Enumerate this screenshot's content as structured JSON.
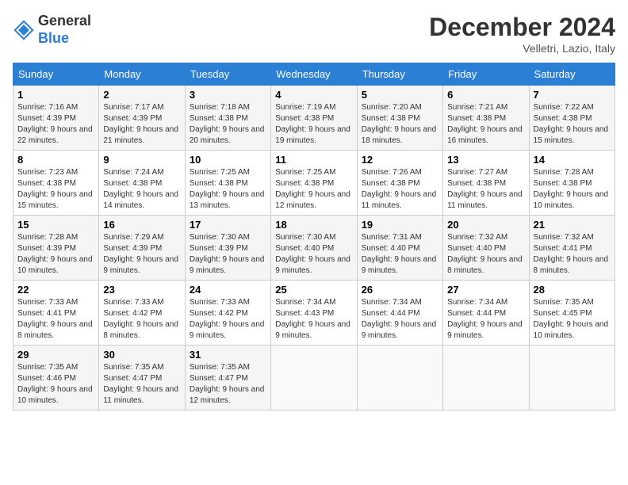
{
  "header": {
    "logo_general": "General",
    "logo_blue": "Blue",
    "month_year": "December 2024",
    "location": "Velletri, Lazio, Italy"
  },
  "weekdays": [
    "Sunday",
    "Monday",
    "Tuesday",
    "Wednesday",
    "Thursday",
    "Friday",
    "Saturday"
  ],
  "weeks": [
    [
      {
        "day": "1",
        "sunrise": "Sunrise: 7:16 AM",
        "sunset": "Sunset: 4:39 PM",
        "daylight": "Daylight: 9 hours and 22 minutes."
      },
      {
        "day": "2",
        "sunrise": "Sunrise: 7:17 AM",
        "sunset": "Sunset: 4:39 PM",
        "daylight": "Daylight: 9 hours and 21 minutes."
      },
      {
        "day": "3",
        "sunrise": "Sunrise: 7:18 AM",
        "sunset": "Sunset: 4:38 PM",
        "daylight": "Daylight: 9 hours and 20 minutes."
      },
      {
        "day": "4",
        "sunrise": "Sunrise: 7:19 AM",
        "sunset": "Sunset: 4:38 PM",
        "daylight": "Daylight: 9 hours and 19 minutes."
      },
      {
        "day": "5",
        "sunrise": "Sunrise: 7:20 AM",
        "sunset": "Sunset: 4:38 PM",
        "daylight": "Daylight: 9 hours and 18 minutes."
      },
      {
        "day": "6",
        "sunrise": "Sunrise: 7:21 AM",
        "sunset": "Sunset: 4:38 PM",
        "daylight": "Daylight: 9 hours and 16 minutes."
      },
      {
        "day": "7",
        "sunrise": "Sunrise: 7:22 AM",
        "sunset": "Sunset: 4:38 PM",
        "daylight": "Daylight: 9 hours and 15 minutes."
      }
    ],
    [
      {
        "day": "8",
        "sunrise": "Sunrise: 7:23 AM",
        "sunset": "Sunset: 4:38 PM",
        "daylight": "Daylight: 9 hours and 15 minutes."
      },
      {
        "day": "9",
        "sunrise": "Sunrise: 7:24 AM",
        "sunset": "Sunset: 4:38 PM",
        "daylight": "Daylight: 9 hours and 14 minutes."
      },
      {
        "day": "10",
        "sunrise": "Sunrise: 7:25 AM",
        "sunset": "Sunset: 4:38 PM",
        "daylight": "Daylight: 9 hours and 13 minutes."
      },
      {
        "day": "11",
        "sunrise": "Sunrise: 7:25 AM",
        "sunset": "Sunset: 4:38 PM",
        "daylight": "Daylight: 9 hours and 12 minutes."
      },
      {
        "day": "12",
        "sunrise": "Sunrise: 7:26 AM",
        "sunset": "Sunset: 4:38 PM",
        "daylight": "Daylight: 9 hours and 11 minutes."
      },
      {
        "day": "13",
        "sunrise": "Sunrise: 7:27 AM",
        "sunset": "Sunset: 4:38 PM",
        "daylight": "Daylight: 9 hours and 11 minutes."
      },
      {
        "day": "14",
        "sunrise": "Sunrise: 7:28 AM",
        "sunset": "Sunset: 4:38 PM",
        "daylight": "Daylight: 9 hours and 10 minutes."
      }
    ],
    [
      {
        "day": "15",
        "sunrise": "Sunrise: 7:28 AM",
        "sunset": "Sunset: 4:39 PM",
        "daylight": "Daylight: 9 hours and 10 minutes."
      },
      {
        "day": "16",
        "sunrise": "Sunrise: 7:29 AM",
        "sunset": "Sunset: 4:39 PM",
        "daylight": "Daylight: 9 hours and 9 minutes."
      },
      {
        "day": "17",
        "sunrise": "Sunrise: 7:30 AM",
        "sunset": "Sunset: 4:39 PM",
        "daylight": "Daylight: 9 hours and 9 minutes."
      },
      {
        "day": "18",
        "sunrise": "Sunrise: 7:30 AM",
        "sunset": "Sunset: 4:40 PM",
        "daylight": "Daylight: 9 hours and 9 minutes."
      },
      {
        "day": "19",
        "sunrise": "Sunrise: 7:31 AM",
        "sunset": "Sunset: 4:40 PM",
        "daylight": "Daylight: 9 hours and 9 minutes."
      },
      {
        "day": "20",
        "sunrise": "Sunrise: 7:32 AM",
        "sunset": "Sunset: 4:40 PM",
        "daylight": "Daylight: 9 hours and 8 minutes."
      },
      {
        "day": "21",
        "sunrise": "Sunrise: 7:32 AM",
        "sunset": "Sunset: 4:41 PM",
        "daylight": "Daylight: 9 hours and 8 minutes."
      }
    ],
    [
      {
        "day": "22",
        "sunrise": "Sunrise: 7:33 AM",
        "sunset": "Sunset: 4:41 PM",
        "daylight": "Daylight: 9 hours and 8 minutes."
      },
      {
        "day": "23",
        "sunrise": "Sunrise: 7:33 AM",
        "sunset": "Sunset: 4:42 PM",
        "daylight": "Daylight: 9 hours and 8 minutes."
      },
      {
        "day": "24",
        "sunrise": "Sunrise: 7:33 AM",
        "sunset": "Sunset: 4:42 PM",
        "daylight": "Daylight: 9 hours and 9 minutes."
      },
      {
        "day": "25",
        "sunrise": "Sunrise: 7:34 AM",
        "sunset": "Sunset: 4:43 PM",
        "daylight": "Daylight: 9 hours and 9 minutes."
      },
      {
        "day": "26",
        "sunrise": "Sunrise: 7:34 AM",
        "sunset": "Sunset: 4:44 PM",
        "daylight": "Daylight: 9 hours and 9 minutes."
      },
      {
        "day": "27",
        "sunrise": "Sunrise: 7:34 AM",
        "sunset": "Sunset: 4:44 PM",
        "daylight": "Daylight: 9 hours and 9 minutes."
      },
      {
        "day": "28",
        "sunrise": "Sunrise: 7:35 AM",
        "sunset": "Sunset: 4:45 PM",
        "daylight": "Daylight: 9 hours and 10 minutes."
      }
    ],
    [
      {
        "day": "29",
        "sunrise": "Sunrise: 7:35 AM",
        "sunset": "Sunset: 4:46 PM",
        "daylight": "Daylight: 9 hours and 10 minutes."
      },
      {
        "day": "30",
        "sunrise": "Sunrise: 7:35 AM",
        "sunset": "Sunset: 4:47 PM",
        "daylight": "Daylight: 9 hours and 11 minutes."
      },
      {
        "day": "31",
        "sunrise": "Sunrise: 7:35 AM",
        "sunset": "Sunset: 4:47 PM",
        "daylight": "Daylight: 9 hours and 12 minutes."
      },
      null,
      null,
      null,
      null
    ]
  ]
}
